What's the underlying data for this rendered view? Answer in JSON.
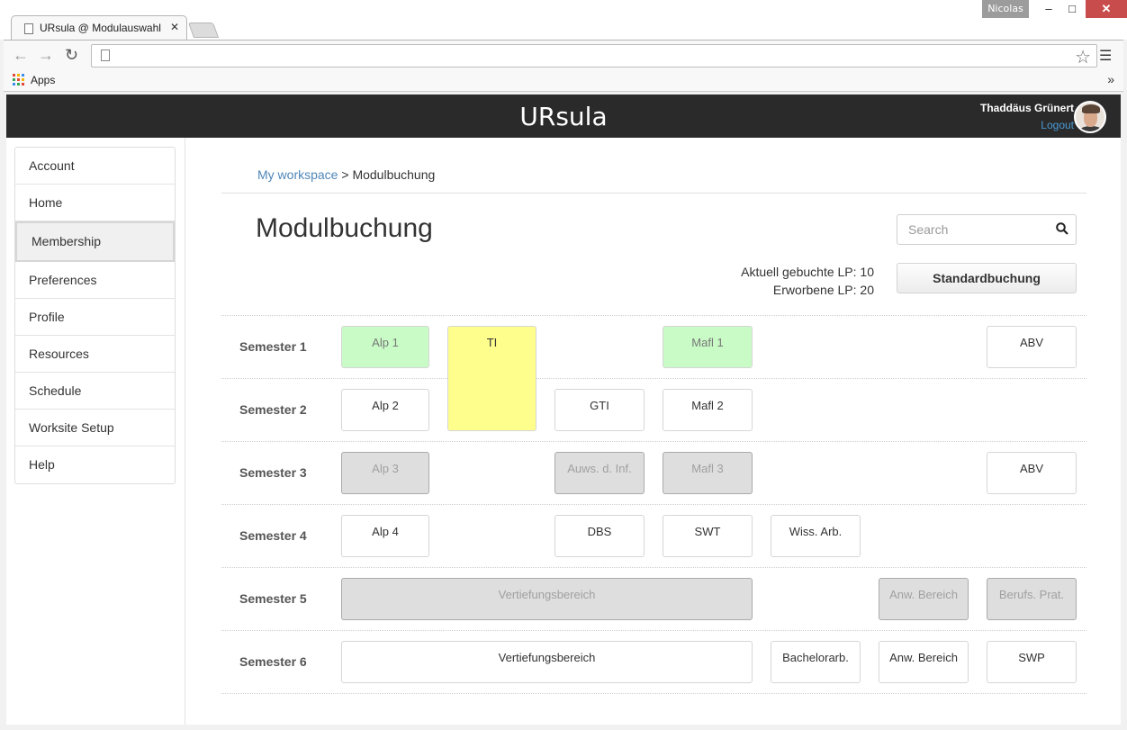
{
  "browser": {
    "profile_name": "Nicolas",
    "tab_title": "URsula @ Modulauswahl",
    "bookmarks_apps_label": "Apps",
    "bookmarks_more": "»",
    "window_buttons": {
      "minimize": "–",
      "maximize": "□",
      "close": "✕"
    }
  },
  "header": {
    "brand": "URsula",
    "user_name": "Thaddäus Grünert",
    "logout_label": "Logout"
  },
  "sidebar": {
    "items": [
      {
        "label": "Account"
      },
      {
        "label": "Home"
      },
      {
        "label": "Membership",
        "active": true
      },
      {
        "label": "Preferences"
      },
      {
        "label": "Profile"
      },
      {
        "label": "Resources"
      },
      {
        "label": "Schedule"
      },
      {
        "label": "Worksite Setup"
      },
      {
        "label": "Help"
      }
    ]
  },
  "breadcrumb": {
    "link": "My workspace",
    "separator": ">",
    "current": "Modulbuchung"
  },
  "page_title": "Modulbuchung",
  "search": {
    "placeholder": "Search",
    "value": ""
  },
  "lp": {
    "current": "Aktuell gebuchte LP: 10",
    "earned": "Erworbene LP: 20"
  },
  "standard_button_label": "Standardbuchung",
  "status_colors": {
    "booked": "#c9fbc6",
    "selected": "#fefe8d",
    "unavailable": "#dedede",
    "available": "#ffffff"
  },
  "semesters": [
    {
      "label": "Semester 1"
    },
    {
      "label": "Semester 2"
    },
    {
      "label": "Semester 3"
    },
    {
      "label": "Semester 4"
    },
    {
      "label": "Semester 5"
    },
    {
      "label": "Semester 6"
    }
  ],
  "modules": {
    "s1_alp1": {
      "label": "Alp 1",
      "status": "booked"
    },
    "s1_ti": {
      "label": "TI",
      "status": "selected"
    },
    "s1_mafl1": {
      "label": "Mafl 1",
      "status": "booked"
    },
    "s1_abv": {
      "label": "ABV",
      "status": "available"
    },
    "s2_alp2": {
      "label": "Alp 2",
      "status": "available"
    },
    "s2_gti": {
      "label": "GTI",
      "status": "available"
    },
    "s2_mafl2": {
      "label": "Mafl 2",
      "status": "available"
    },
    "s3_alp3": {
      "label": "Alp 3",
      "status": "unavailable"
    },
    "s3_auws": {
      "label": "Auws. d. Inf.",
      "status": "unavailable"
    },
    "s3_mafl3": {
      "label": "Mafl 3",
      "status": "unavailable"
    },
    "s3_abv": {
      "label": "ABV",
      "status": "available"
    },
    "s4_alp4": {
      "label": "Alp 4",
      "status": "available"
    },
    "s4_dbs": {
      "label": "DBS",
      "status": "available"
    },
    "s4_swt": {
      "label": "SWT",
      "status": "available"
    },
    "s4_wiss": {
      "label": "Wiss. Arb.",
      "status": "available"
    },
    "s5_vert": {
      "label": "Vertiefungsbereich",
      "status": "unavailable"
    },
    "s5_anw": {
      "label": "Anw. Bereich",
      "status": "unavailable"
    },
    "s5_berufs": {
      "label": "Berufs. Prat.",
      "status": "unavailable"
    },
    "s6_vert": {
      "label": "Vertiefungsbereich",
      "status": "available"
    },
    "s6_bach": {
      "label": "Bachelorarb.",
      "status": "available"
    },
    "s6_anw": {
      "label": "Anw. Bereich",
      "status": "available"
    },
    "s6_swp": {
      "label": "SWP",
      "status": "available"
    }
  }
}
